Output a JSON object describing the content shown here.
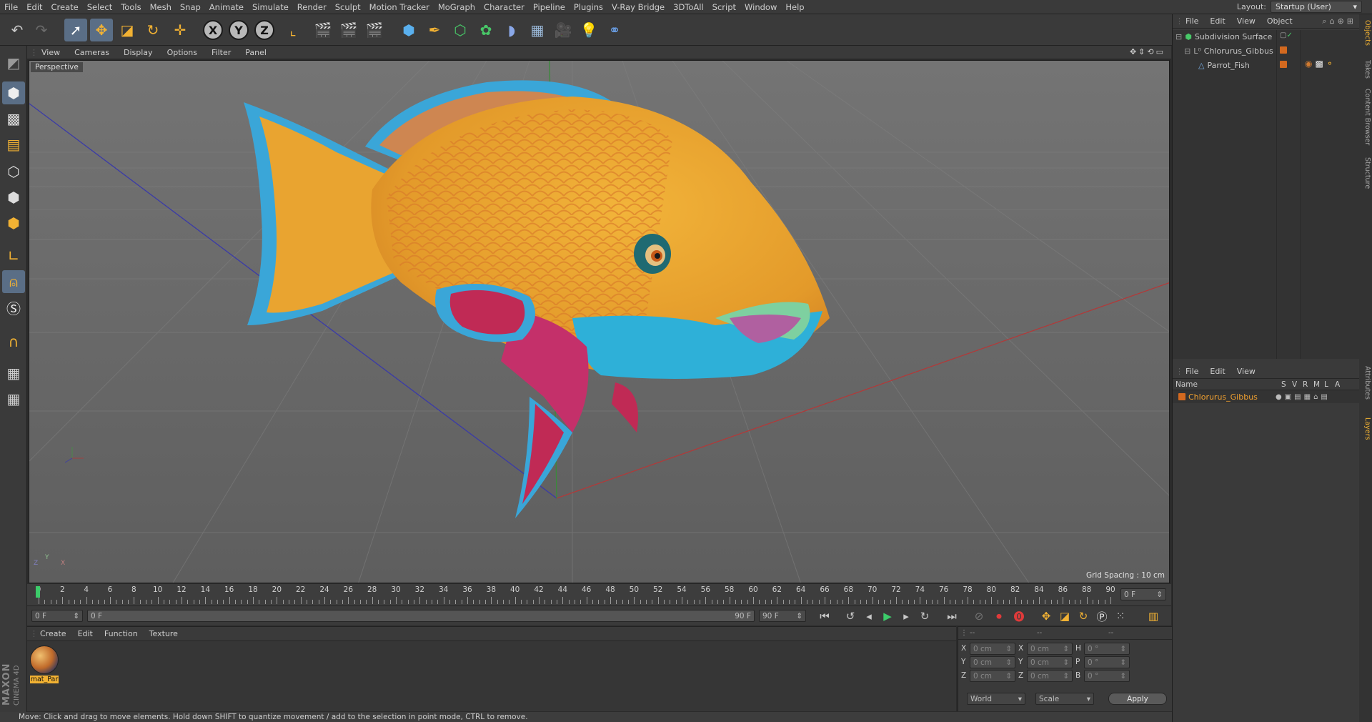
{
  "menubar": {
    "items": [
      "File",
      "Edit",
      "Create",
      "Select",
      "Tools",
      "Mesh",
      "Snap",
      "Animate",
      "Simulate",
      "Render",
      "Sculpt",
      "Motion Tracker",
      "MoGraph",
      "Character",
      "Pipeline",
      "Plugins",
      "V-Ray Bridge",
      "3DToAll",
      "Script",
      "Window",
      "Help"
    ],
    "layout_label": "Layout:",
    "layout_value": "Startup (User)"
  },
  "viewport": {
    "menu": [
      "View",
      "Cameras",
      "Display",
      "Options",
      "Filter",
      "Panel"
    ],
    "label": "Perspective",
    "grid_spacing": "Grid Spacing : 10 cm",
    "axis_y": "Y",
    "axis_z": "Z",
    "axis_x": "X"
  },
  "timeline": {
    "ticks": [
      "0",
      "2",
      "4",
      "6",
      "8",
      "10",
      "12",
      "14",
      "16",
      "18",
      "20",
      "22",
      "24",
      "26",
      "28",
      "30",
      "32",
      "34",
      "36",
      "38",
      "40",
      "42",
      "44",
      "46",
      "48",
      "50",
      "52",
      "54",
      "56",
      "58",
      "60",
      "62",
      "64",
      "66",
      "68",
      "70",
      "72",
      "74",
      "76",
      "78",
      "80",
      "82",
      "84",
      "86",
      "88",
      "90"
    ],
    "current_frame_right": "0 F"
  },
  "transport": {
    "start_field": "0 F",
    "range_start": "0 F",
    "range_end": "90 F",
    "end_field": "90 F"
  },
  "material_panel": {
    "menu": [
      "Create",
      "Edit",
      "Function",
      "Texture"
    ],
    "material_name": "mat_Par",
    "brand_top": "MAXON",
    "brand_bottom": "CINEMA 4D"
  },
  "coord_panel": {
    "header_left": "--",
    "header_mid": "--",
    "header_right": "--",
    "rows": [
      {
        "a": "X",
        "av": "0 cm",
        "b": "X",
        "bv": "0 cm",
        "c": "H",
        "cv": "0 °"
      },
      {
        "a": "Y",
        "av": "0 cm",
        "b": "Y",
        "bv": "0 cm",
        "c": "P",
        "cv": "0 °"
      },
      {
        "a": "Z",
        "av": "0 cm",
        "b": "Z",
        "bv": "0 cm",
        "c": "B",
        "cv": "0 °"
      }
    ],
    "world": "World",
    "scale": "Scale",
    "apply": "Apply"
  },
  "status": "Move: Click and drag to move elements. Hold down SHIFT to quantize movement / add to the selection in point mode, CTRL to remove.",
  "objects_panel": {
    "menu": [
      "File",
      "Edit",
      "View",
      "Object"
    ],
    "items": [
      {
        "name": "Subdivision Surface"
      },
      {
        "name": "Chlorurus_Gibbus"
      },
      {
        "name": "Parrot_Fish"
      }
    ]
  },
  "layers_panel": {
    "menu": [
      "File",
      "Edit",
      "View"
    ],
    "cols": [
      "Name",
      "S",
      "V",
      "R",
      "M",
      "L",
      "A"
    ],
    "layer_name": "Chlorurus_Gibbus"
  },
  "side_tabs": [
    "Objects",
    "Takes",
    "Content Browser",
    "Structure",
    "Attributes",
    "Layers"
  ],
  "colors": {
    "accent": "#5a6e86",
    "layer_orange": "#d3691f",
    "highlight_text": "#f0a030"
  }
}
